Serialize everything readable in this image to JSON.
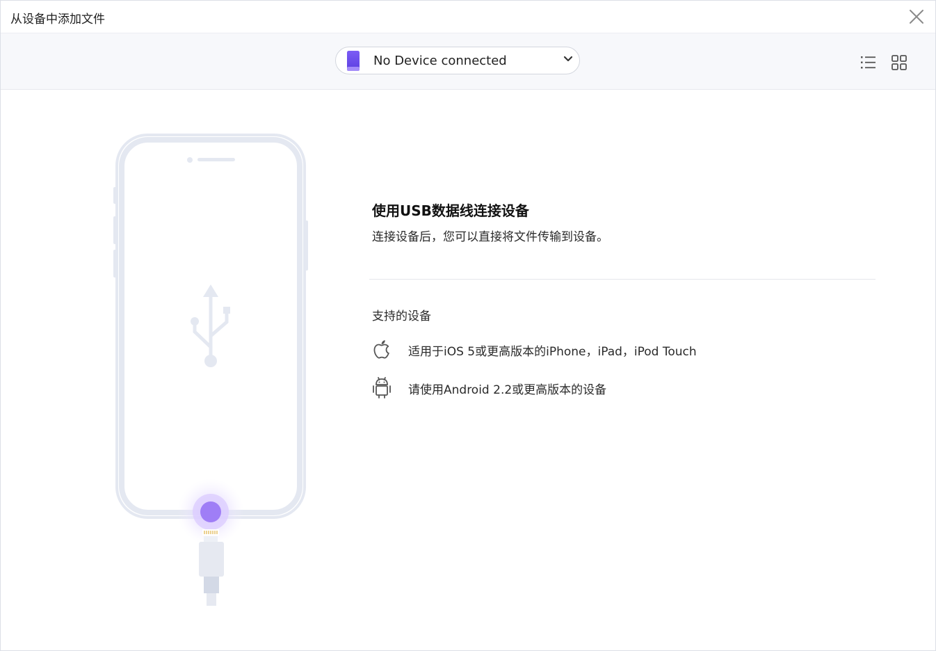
{
  "window": {
    "title": "从设备中添加文件"
  },
  "toolbar": {
    "device_selector": {
      "selected_label": "No Device connected"
    },
    "icons": [
      "device-phone-icon",
      "chevron-down-icon",
      "list-view-icon",
      "grid-view-icon",
      "close-icon"
    ]
  },
  "main": {
    "heading": "使用USB数据线连接设备",
    "subtext": "连接设备后，您可以直接将文件传输到设备。",
    "supported": {
      "title": "支持的设备",
      "items": [
        {
          "icon": "apple-icon",
          "text": "适用于iOS 5或更高版本的iPhone，iPad，iPod Touch"
        },
        {
          "icon": "android-icon",
          "text": "请使用Android 2.2或更高版本的设备"
        }
      ]
    }
  },
  "colors": {
    "accent": "#8b5cf6",
    "illustration_stroke": "#e4e8f1",
    "toolbar_bg": "#f7f8fb"
  }
}
